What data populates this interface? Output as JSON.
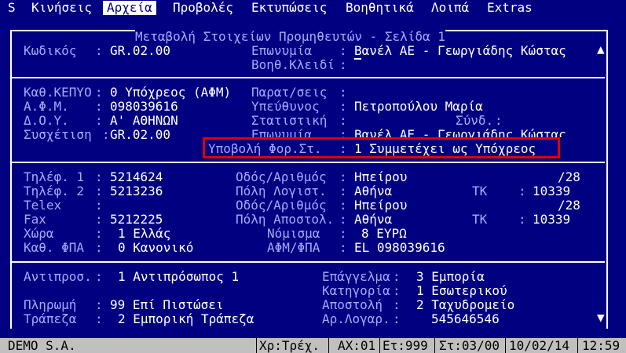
{
  "menu": {
    "items": [
      "S",
      "Κινήσεις",
      "Αρχεία",
      "Προβολές",
      "Εκτυπώσεις",
      "Βοηθητικά",
      "Λοιπά",
      "Extras"
    ],
    "active": "Αρχεία"
  },
  "window": {
    "title": "Μεταβολή Στοιχείων Προμηθευτών - Σελίδα 1"
  },
  "section1": {
    "code_label": "Κωδικός",
    "code_value": "GR.02.00",
    "name_label": "Επωνυμία",
    "name_value": "Βανέλ ΑΕ - Γεωργιάδης Κώστας",
    "key_label": "Βοηθ.Κλειδί",
    "key_value": ""
  },
  "section2": {
    "kepyo_label": "Καθ.ΚΕΠΥΟ",
    "kepyo_value": "0 Υπόχρεος (ΑΦΜ)",
    "afm_label": "Α.Φ.Μ.",
    "afm_value": "098039616",
    "doy_label": "Δ.Ο.Υ.",
    "doy_value": "Α' ΑΘΗΝΩΝ",
    "link_label": "Συσχέτιση",
    "link_value": "GR.02.00",
    "notes_label": "Παρατ/σεις",
    "notes_value": "",
    "resp_label": "Υπεύθυνος",
    "resp_value": "Πετροπούλου Μαρία",
    "stat_label": "Στατιστική",
    "stat_value": "",
    "synd_label": "Σύνδ.",
    "synd_value": "",
    "name2_label": "Επωνυμία",
    "name2_value": "Βανέλ ΑΕ - Γεωργιάδης Κώστας",
    "submit_label": "Υποβολή Φορ.Στ.",
    "submit_value": "1 Συμμετέχει ως Υπόχρεος"
  },
  "section3": {
    "tel1_label": "Τηλέφ. 1",
    "tel1_value": "5214624",
    "tel2_label": "Τηλέφ. 2",
    "tel2_value": "5213236",
    "telex_label": "Telex",
    "telex_value": "",
    "fax_label": "Fax",
    "fax_value": "5212225",
    "country_label": "Χώρα",
    "country_value": "1 Ελλάς",
    "vat_label": "Καθ. ΦΠΑ",
    "vat_value": "0 Κανονικό",
    "street1_label": "Οδός/Αριθμός",
    "street1_value": "Ηπείρου",
    "street1_num": "/28",
    "city1_label": "Πόλη Λογιστ.",
    "city1_value": "Αθήνα",
    "tk1_label": "ΤΚ",
    "tk1_value": "10339",
    "street2_label": "Οδός/Αριθμός",
    "street2_value": "Ηπείρου",
    "street2_num": "/28",
    "city2_label": "Πόλη Αποστολ.",
    "city2_value": "Αθήνα",
    "tk2_label": "ΤΚ",
    "tk2_value": "10339",
    "currency_label": "Νόμισμα",
    "currency_value": "8 ΕΥΡΩ",
    "afmvat_label": "ΑΦΜ/ΦΠΑ",
    "afmvat_value": "EL 098039616"
  },
  "section4": {
    "rep_label": "Αντιπροσ.",
    "rep_value": "1 Αντιπρόσωπος 1",
    "pay_label": "Πληρωμή",
    "pay_value": "99 Επί Πιστώσει",
    "bank_label": "Τράπεζα",
    "bank_value": "2 Εμπορική Τράπεζα",
    "prof_label": "Επάγγελμα",
    "prof_value": "3 Εμπορία",
    "cat_label": "Κατηγορία",
    "cat_value": "1 Εσωτερικού",
    "ship_label": "Αποστολή",
    "ship_value": "2 Ταχυδρομείο",
    "acct_label": "Αρ.Λογαρ.",
    "acct_value": "545646546"
  },
  "statusbar": {
    "company": "DEMO S.A.",
    "period": "Χρ:Τρέχ.",
    "ax": "ΑΧ:01",
    "year": "Ετ:999",
    "station": "Στ:03/00",
    "date": "10/02/14",
    "time": "12:59"
  }
}
